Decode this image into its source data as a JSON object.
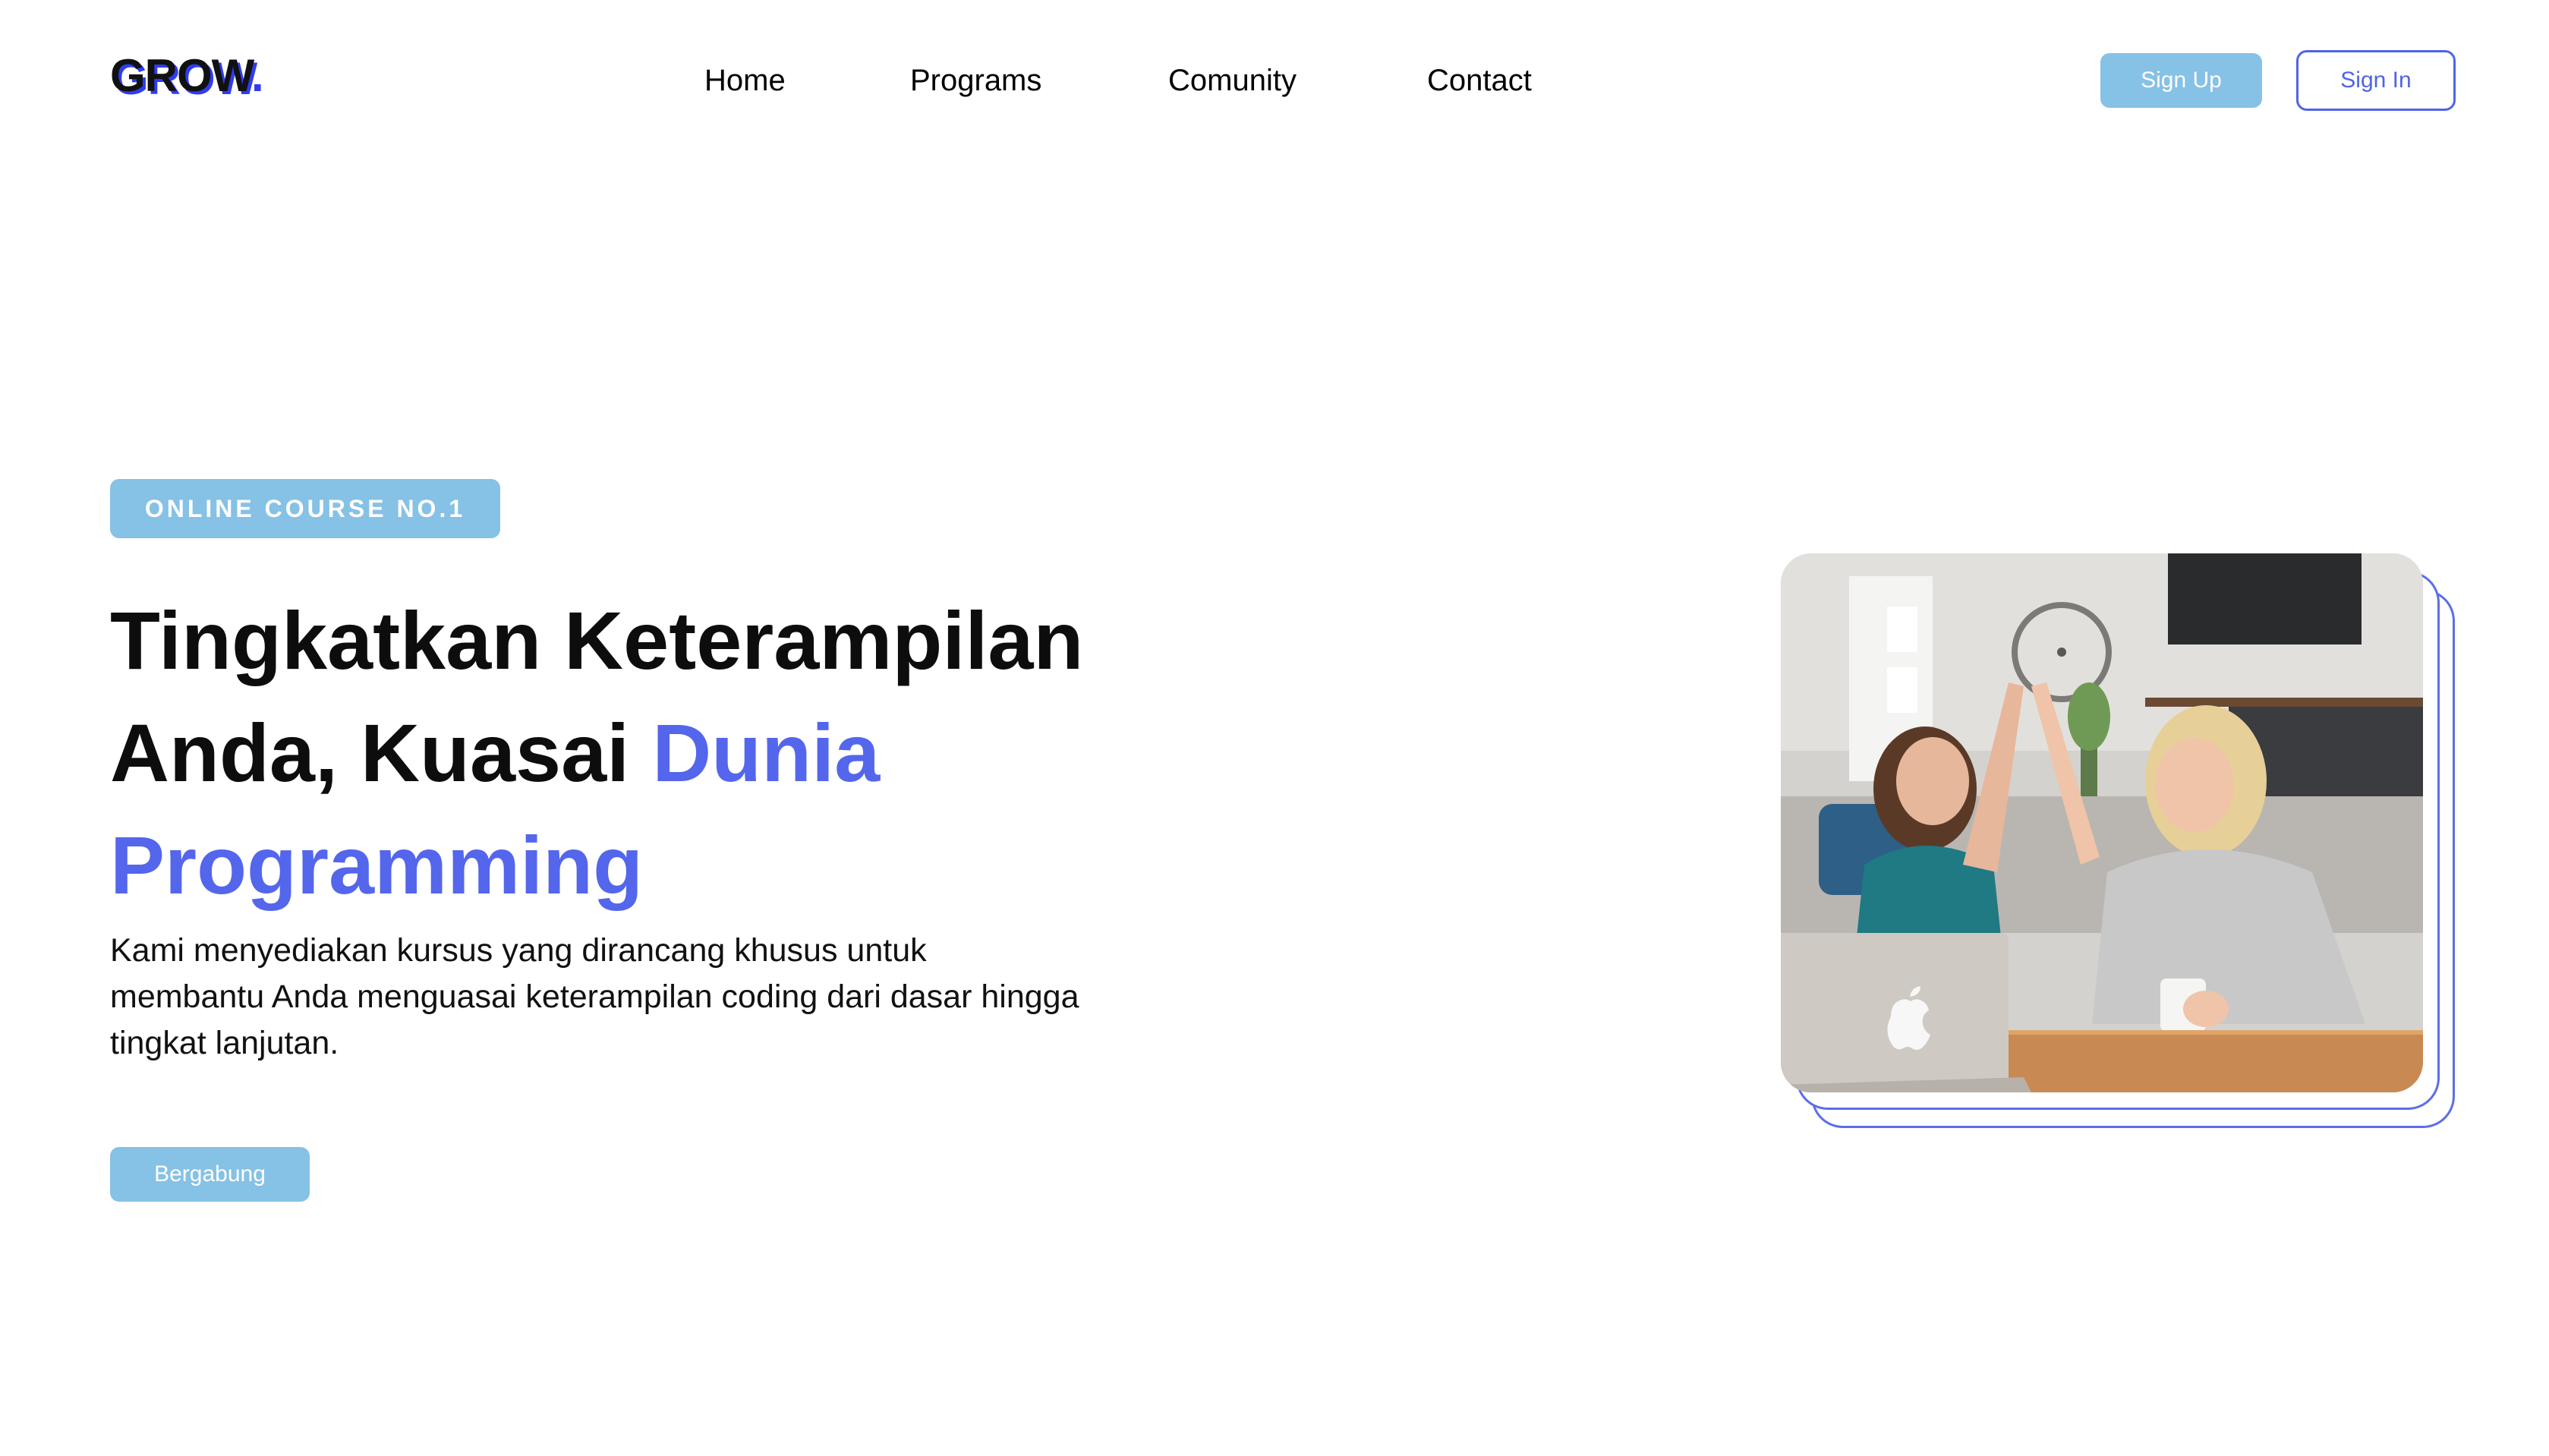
{
  "header": {
    "logo_text": "GROW",
    "logo_dot": ".",
    "nav": [
      {
        "label": "Home"
      },
      {
        "label": "Programs"
      },
      {
        "label": "Comunity"
      },
      {
        "label": "Contact"
      }
    ],
    "sign_up_label": "Sign Up",
    "sign_in_label": "Sign In"
  },
  "hero": {
    "badge": "ONLINE COURSE NO.1",
    "headline_line1": "Tingkatkan Keterampilan",
    "headline_line2_plain": "Anda, Kuasai ",
    "headline_line2_accent": "Dunia",
    "headline_line3_accent": "Programming",
    "description": "Kami menyediakan kursus yang dirancang khusus untuk membantu Anda menguasai keterampilan coding dari dasar hingga tingkat lanjutan.",
    "join_label": "Bergabung"
  },
  "colors": {
    "accent_blue": "#5466ec",
    "button_light_blue": "#86c1e6",
    "outline_blue": "#4f64e6",
    "text": "#0d0d0d"
  },
  "icons": {
    "laptop_logo": "apple-logo-icon"
  }
}
